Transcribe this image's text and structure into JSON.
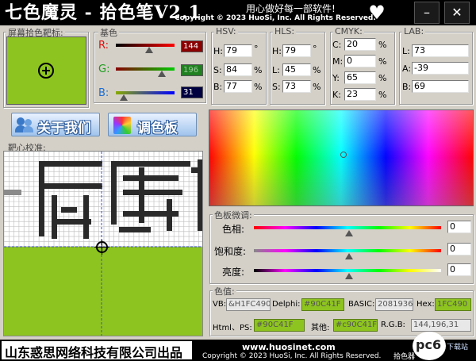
{
  "window": {
    "title": "七色魔灵 - 拾色笔V2.1",
    "slogan": "用心做好每一部软件!",
    "copyright": "Copyright © 2023 HuoSi, Inc. All Rights Reserved.",
    "minimize_icon": "minimize-icon",
    "close_icon": "close-icon"
  },
  "colors": {
    "current": "#8EC41F",
    "accent_blue": "#2f5c9a",
    "title_bg": "#000000"
  },
  "picker_target": {
    "label": "屏幕拾色靶标:"
  },
  "base_colors": {
    "label": "基色",
    "r_label": "R:",
    "g_label": "G:",
    "b_label": "B:",
    "r_value": "144",
    "g_value": "196",
    "b_value": "31"
  },
  "hsv": {
    "label": "HSV:",
    "h_label": "H:",
    "s_label": "S:",
    "b_label": "B:",
    "h": "79",
    "s": "84",
    "b": "77",
    "h_unit": "°",
    "s_unit": "%",
    "b_unit": "%"
  },
  "hls": {
    "label": "HLS:",
    "h_label": "H:",
    "l_label": "L:",
    "s_label": "S:",
    "h": "79",
    "l": "45",
    "s": "73",
    "h_unit": "°",
    "l_unit": "%",
    "s_unit": "%"
  },
  "cmyk": {
    "label": "CMYK:",
    "c_label": "C:",
    "m_label": "M:",
    "y_label": "Y:",
    "k_label": "K:",
    "c": "20",
    "m": "0",
    "y": "65",
    "k": "23",
    "unit": "%"
  },
  "lab": {
    "label": "LAB:",
    "l_label": "L:",
    "a_label": "A:",
    "b_label": "B:",
    "l": "73",
    "a": "-39",
    "b": "69"
  },
  "buttons": {
    "about": "关于我们",
    "palette": "调色板"
  },
  "calibration": {
    "label": "靶心校准:",
    "preview_text": "屏幕拾"
  },
  "fine_tune": {
    "label": "色板微调:",
    "hue_label": "色相:",
    "saturation_label": "饱和度:",
    "brightness_label": "亮度:",
    "hue_value": "0",
    "saturation_value": "0",
    "brightness_value": "0"
  },
  "color_values": {
    "label": "色值:",
    "vb_label": "VB:",
    "vb": "&H1FC490",
    "delphi_label": "Delphi:",
    "delphi": "#90C41F",
    "basic_label": "BASIC:",
    "basic": "2081936",
    "hex_label": "Hex:",
    "hex": "1FC490",
    "html_label": "Html、PS:",
    "html": "#90C41F",
    "other_label": "其他:",
    "other": "#c90C41F",
    "rgb_label": "R.G.B:",
    "rgb": "144,196,31"
  },
  "footer": {
    "company": "山东惑思网络科技有限公司出品",
    "website": "www.huosinet.com",
    "copyright": "Copyright © 2023 HuoSi, Inc. All Rights Reserved.",
    "watermark": "pc6",
    "watermark_sub": "下载站",
    "watermark_tag": "拾色器"
  }
}
